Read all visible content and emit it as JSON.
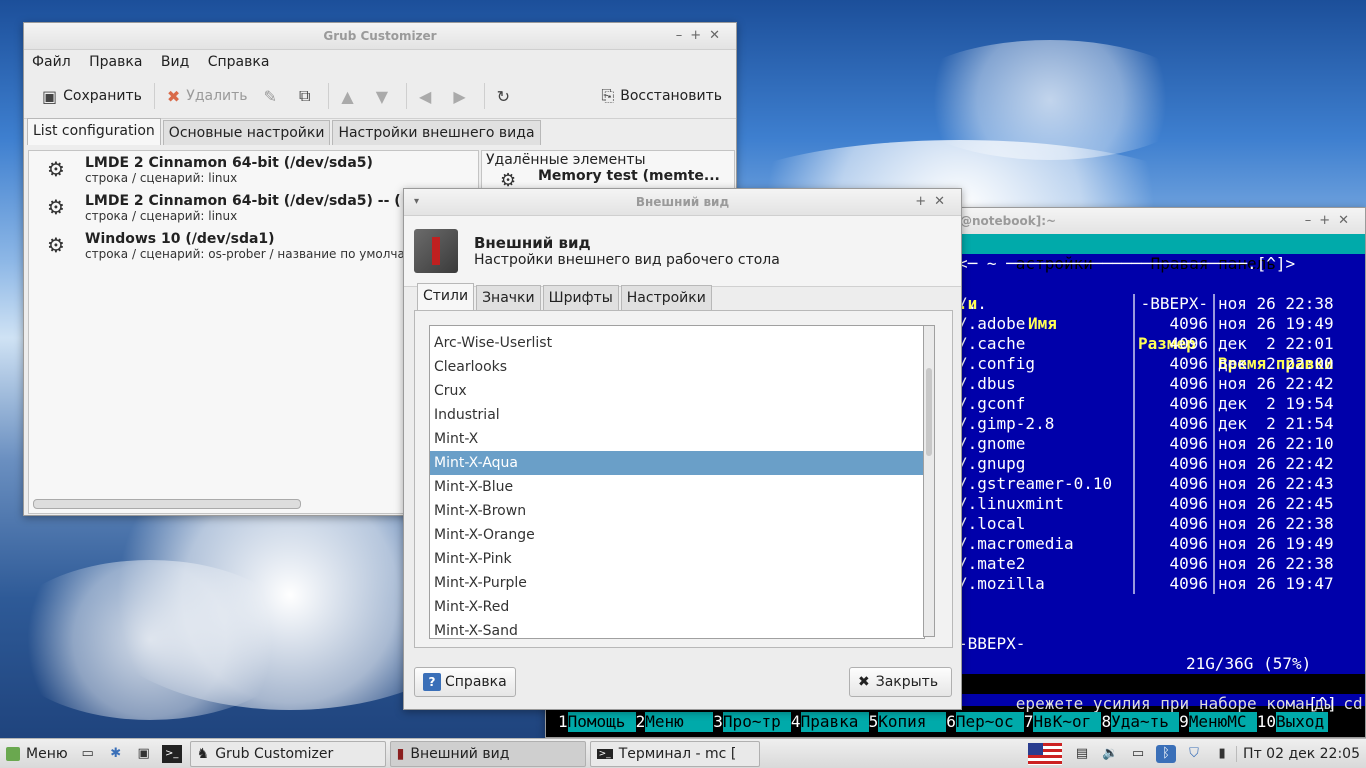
{
  "grub_window": {
    "title": "Grub Customizer",
    "menu": [
      "Файл",
      "Правка",
      "Вид",
      "Справка"
    ],
    "toolbar": {
      "save": "Сохранить",
      "delete": "Удалить",
      "restore": "Восстановить"
    },
    "tabs": [
      "List configuration",
      "Основные настройки",
      "Настройки внешнего вида"
    ],
    "entries": [
      {
        "title": "LMDE 2 Cinnamon 64-bit (/dev/sda5)",
        "subtitle": "строка / сценарий: linux"
      },
      {
        "title": "LMDE 2 Cinnamon 64-bit (/dev/sda5) -- (",
        "subtitle": "строка / сценарий: linux"
      },
      {
        "title": "Windows 10 (/dev/sda1)",
        "subtitle": "строка / сценарий: os-prober / название по умолча"
      }
    ],
    "removed_header": "Удалённые элементы",
    "removed_item": "Memory test (memte..."
  },
  "appearance_dialog": {
    "title": "Внешний вид",
    "heading": "Внешний вид",
    "subheading": "Настройки внешнего вид рабочего стола",
    "tabs": [
      "Стили",
      "Значки",
      "Шрифты",
      "Настройки"
    ],
    "styles": [
      "Arc-Wise-Userlist",
      "Clearlooks",
      "Crux",
      "Industrial",
      "Mint-X",
      "Mint-X-Aqua",
      "Mint-X-Blue",
      "Mint-X-Brown",
      "Mint-X-Orange",
      "Mint-X-Pink",
      "Mint-X-Purple",
      "Mint-X-Red",
      "Mint-X-Sand"
    ],
    "selected_style": "Mint-X-Aqua",
    "help_button": "Справка",
    "close_button": "Закрыть"
  },
  "terminal": {
    "title": "@notebook]:~",
    "menu_right": "астройки",
    "menu_panel": "Правая панель",
    "header_top": "<─ ~ ─────────────────────────.[^]>",
    "col_n": ".и",
    "col_name": "Имя",
    "col_size": "Размер",
    "col_time": "Время правки",
    "rows": [
      {
        "name": "/..",
        "size": "-ВВЕРХ-",
        "time": "ноя 26 22:38"
      },
      {
        "name": "/.adobe",
        "size": "4096",
        "time": "ноя 26 19:49"
      },
      {
        "name": "/.cache",
        "size": "4096",
        "time": "дек  2 22:01"
      },
      {
        "name": "/.config",
        "size": "4096",
        "time": "дек  2 22:00"
      },
      {
        "name": "/.dbus",
        "size": "4096",
        "time": "ноя 26 22:42"
      },
      {
        "name": "/.gconf",
        "size": "4096",
        "time": "дек  2 19:54"
      },
      {
        "name": "/.gimp-2.8",
        "size": "4096",
        "time": "дек  2 21:54"
      },
      {
        "name": "/.gnome",
        "size": "4096",
        "time": "ноя 26 22:10"
      },
      {
        "name": "/.gnupg",
        "size": "4096",
        "time": "ноя 26 22:42"
      },
      {
        "name": "/.gstreamer-0.10",
        "size": "4096",
        "time": "ноя 26 22:43"
      },
      {
        "name": "/.linuxmint",
        "size": "4096",
        "time": "ноя 26 22:45"
      },
      {
        "name": "/.local",
        "size": "4096",
        "time": "ноя 26 22:38"
      },
      {
        "name": "/.macromedia",
        "size": "4096",
        "time": "ноя 26 19:49"
      },
      {
        "name": "/.mate2",
        "size": "4096",
        "time": "ноя 26 22:38"
      },
      {
        "name": "/.mozilla",
        "size": "4096",
        "time": "ноя 26 19:47"
      }
    ],
    "status_up": "-ВВЕРХ-",
    "disk": "21G/36G (57%)",
    "hint": "ережете усилия при наборе команды cd.",
    "hint_tag": "[^]",
    "fkeys": [
      {
        "n": "1",
        "l": "Помощь"
      },
      {
        "n": "2",
        "l": "Меню"
      },
      {
        "n": "3",
        "l": "Про~тр"
      },
      {
        "n": "4",
        "l": "Правка"
      },
      {
        "n": "5",
        "l": "Копия"
      },
      {
        "n": "6",
        "l": "Пер~ос"
      },
      {
        "n": "7",
        "l": "НвК~ог"
      },
      {
        "n": "8",
        "l": "Уда~ть"
      },
      {
        "n": "9",
        "l": "МенюMC"
      },
      {
        "n": "10",
        "l": "Выход"
      }
    ]
  },
  "taskbar": {
    "menu": "Меню",
    "tasks": [
      "Grub Customizer",
      "Внешний вид",
      "Терминал - mc ["
    ],
    "clock": "Пт 02 дек 22:05"
  }
}
